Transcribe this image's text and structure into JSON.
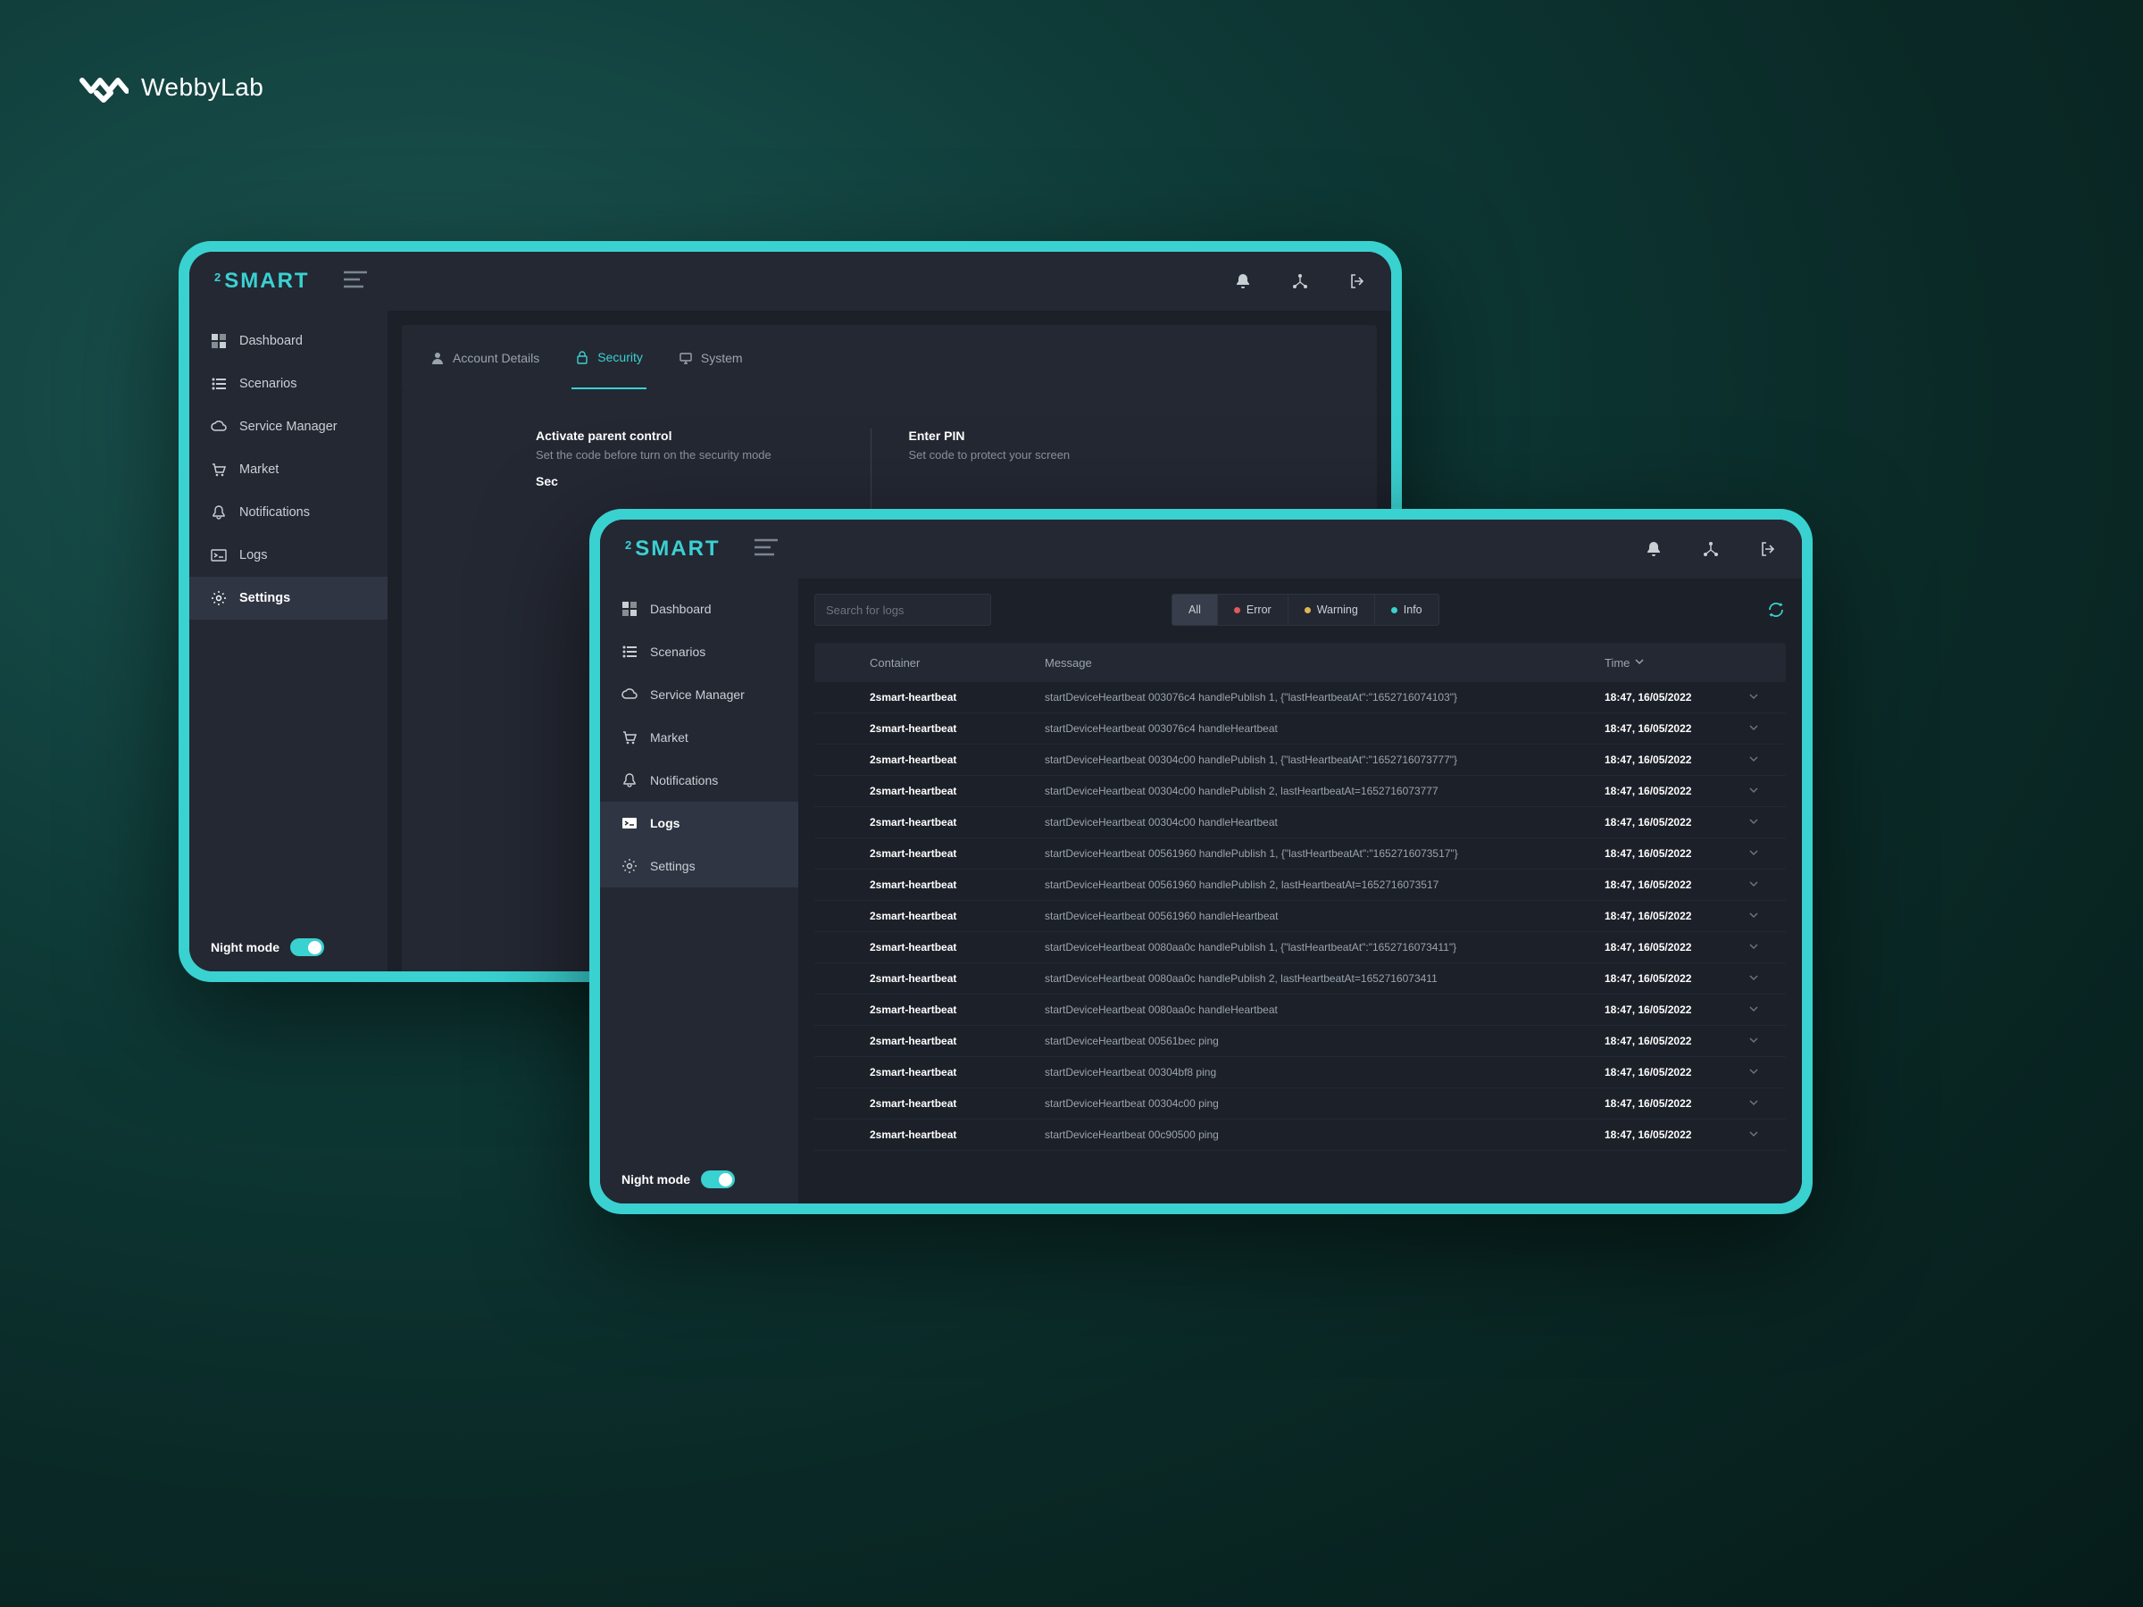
{
  "brand": "WebbyLab",
  "app_name": "SMART",
  "night_mode_label": "Night mode",
  "sidebar": {
    "items": [
      {
        "label": "Dashboard"
      },
      {
        "label": "Scenarios"
      },
      {
        "label": "Service Manager"
      },
      {
        "label": "Market"
      },
      {
        "label": "Notifications"
      },
      {
        "label": "Logs"
      },
      {
        "label": "Settings"
      }
    ]
  },
  "settings": {
    "tabs": [
      {
        "label": "Account Details"
      },
      {
        "label": "Security"
      },
      {
        "label": "System"
      }
    ],
    "col1": {
      "title": "Activate parent control",
      "sub": "Set the code before turn on the security mode",
      "row2": "Sec"
    },
    "col2": {
      "title": "Enter PIN",
      "sub": "Set code to protect your screen"
    }
  },
  "logs": {
    "search_placeholder": "Search for logs",
    "filters": {
      "all": "All",
      "error": "Error",
      "warning": "Warning",
      "info": "Info"
    },
    "headers": {
      "container": "Container",
      "message": "Message",
      "time": "Time"
    },
    "rows": [
      {
        "c": "2smart-heartbeat",
        "m": "startDeviceHeartbeat 003076c4 handlePublish 1, {\"lastHeartbeatAt\":\"1652716074103\"}",
        "t": "18:47, 16/05/2022"
      },
      {
        "c": "2smart-heartbeat",
        "m": "startDeviceHeartbeat 003076c4 handleHeartbeat",
        "t": "18:47, 16/05/2022"
      },
      {
        "c": "2smart-heartbeat",
        "m": "startDeviceHeartbeat 00304c00 handlePublish 1, {\"lastHeartbeatAt\":\"1652716073777\"}",
        "t": "18:47, 16/05/2022"
      },
      {
        "c": "2smart-heartbeat",
        "m": "startDeviceHeartbeat 00304c00 handlePublish 2, lastHeartbeatAt=1652716073777",
        "t": "18:47, 16/05/2022"
      },
      {
        "c": "2smart-heartbeat",
        "m": "startDeviceHeartbeat 00304c00 handleHeartbeat",
        "t": "18:47, 16/05/2022"
      },
      {
        "c": "2smart-heartbeat",
        "m": "startDeviceHeartbeat 00561960 handlePublish 1, {\"lastHeartbeatAt\":\"1652716073517\"}",
        "t": "18:47, 16/05/2022"
      },
      {
        "c": "2smart-heartbeat",
        "m": "startDeviceHeartbeat 00561960 handlePublish 2, lastHeartbeatAt=1652716073517",
        "t": "18:47, 16/05/2022"
      },
      {
        "c": "2smart-heartbeat",
        "m": "startDeviceHeartbeat 00561960 handleHeartbeat",
        "t": "18:47, 16/05/2022"
      },
      {
        "c": "2smart-heartbeat",
        "m": "startDeviceHeartbeat 0080aa0c handlePublish 1, {\"lastHeartbeatAt\":\"1652716073411\"}",
        "t": "18:47, 16/05/2022"
      },
      {
        "c": "2smart-heartbeat",
        "m": "startDeviceHeartbeat 0080aa0c handlePublish 2, lastHeartbeatAt=1652716073411",
        "t": "18:47, 16/05/2022"
      },
      {
        "c": "2smart-heartbeat",
        "m": "startDeviceHeartbeat 0080aa0c handleHeartbeat",
        "t": "18:47, 16/05/2022"
      },
      {
        "c": "2smart-heartbeat",
        "m": "startDeviceHeartbeat 00561bec ping",
        "t": "18:47, 16/05/2022"
      },
      {
        "c": "2smart-heartbeat",
        "m": "startDeviceHeartbeat 00304bf8 ping",
        "t": "18:47, 16/05/2022"
      },
      {
        "c": "2smart-heartbeat",
        "m": "startDeviceHeartbeat 00304c00 ping",
        "t": "18:47, 16/05/2022"
      },
      {
        "c": "2smart-heartbeat",
        "m": "startDeviceHeartbeat 00c90500 ping",
        "t": "18:47, 16/05/2022"
      }
    ]
  }
}
